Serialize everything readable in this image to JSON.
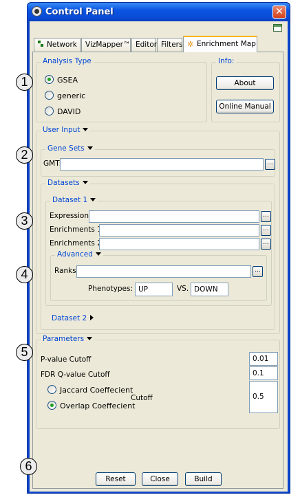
{
  "window": {
    "title": "Control Panel"
  },
  "tabs": [
    {
      "label": "Network"
    },
    {
      "label": "VizMapper™"
    },
    {
      "label": "Editor"
    },
    {
      "label": "Filters"
    },
    {
      "label": "Enrichment Map",
      "active": true
    }
  ],
  "analysis_type": {
    "title": "Analysis Type",
    "options": [
      "GSEA",
      "generic",
      "DAVID"
    ],
    "selected": "GSEA"
  },
  "info": {
    "title": "Info:",
    "about_label": "About",
    "manual_label": "Online Manual"
  },
  "user_input": {
    "title": "User Input",
    "gene_sets": {
      "title": "Gene Sets",
      "gmt_label": "GMT:",
      "gmt_value": ""
    },
    "datasets": {
      "title": "Datasets",
      "dataset1": {
        "title": "Dataset 1",
        "expression_label": "Expression:",
        "enrichments1_label": "Enrichments 1:",
        "enrichments2_label": "Enrichments 2:",
        "advanced": {
          "title": "Advanced",
          "ranks_label": "Ranks:",
          "phenotypes_label": "Phenotypes:",
          "phenotype1": "UP",
          "vs_label": "VS.",
          "phenotype2": "DOWN"
        }
      },
      "dataset2": {
        "title": "Dataset 2"
      }
    }
  },
  "parameters": {
    "title": "Parameters",
    "pvalue_label": "P-value Cutoff",
    "pvalue": "0.01",
    "fdr_label": "FDR Q-value Cutoff",
    "fdr": "0.1",
    "jaccard_label": "Jaccard Coeffecient",
    "overlap_label": "Overlap Coeffecient",
    "cutoff_label": "Cutoff",
    "cutoff": "0.5",
    "selected": "Overlap Coeffecient"
  },
  "footer": {
    "reset_label": "Reset",
    "close_label": "Close",
    "build_label": "Build"
  },
  "callouts": [
    "1",
    "2",
    "3",
    "4",
    "5",
    "6"
  ],
  "browse_label": "..."
}
